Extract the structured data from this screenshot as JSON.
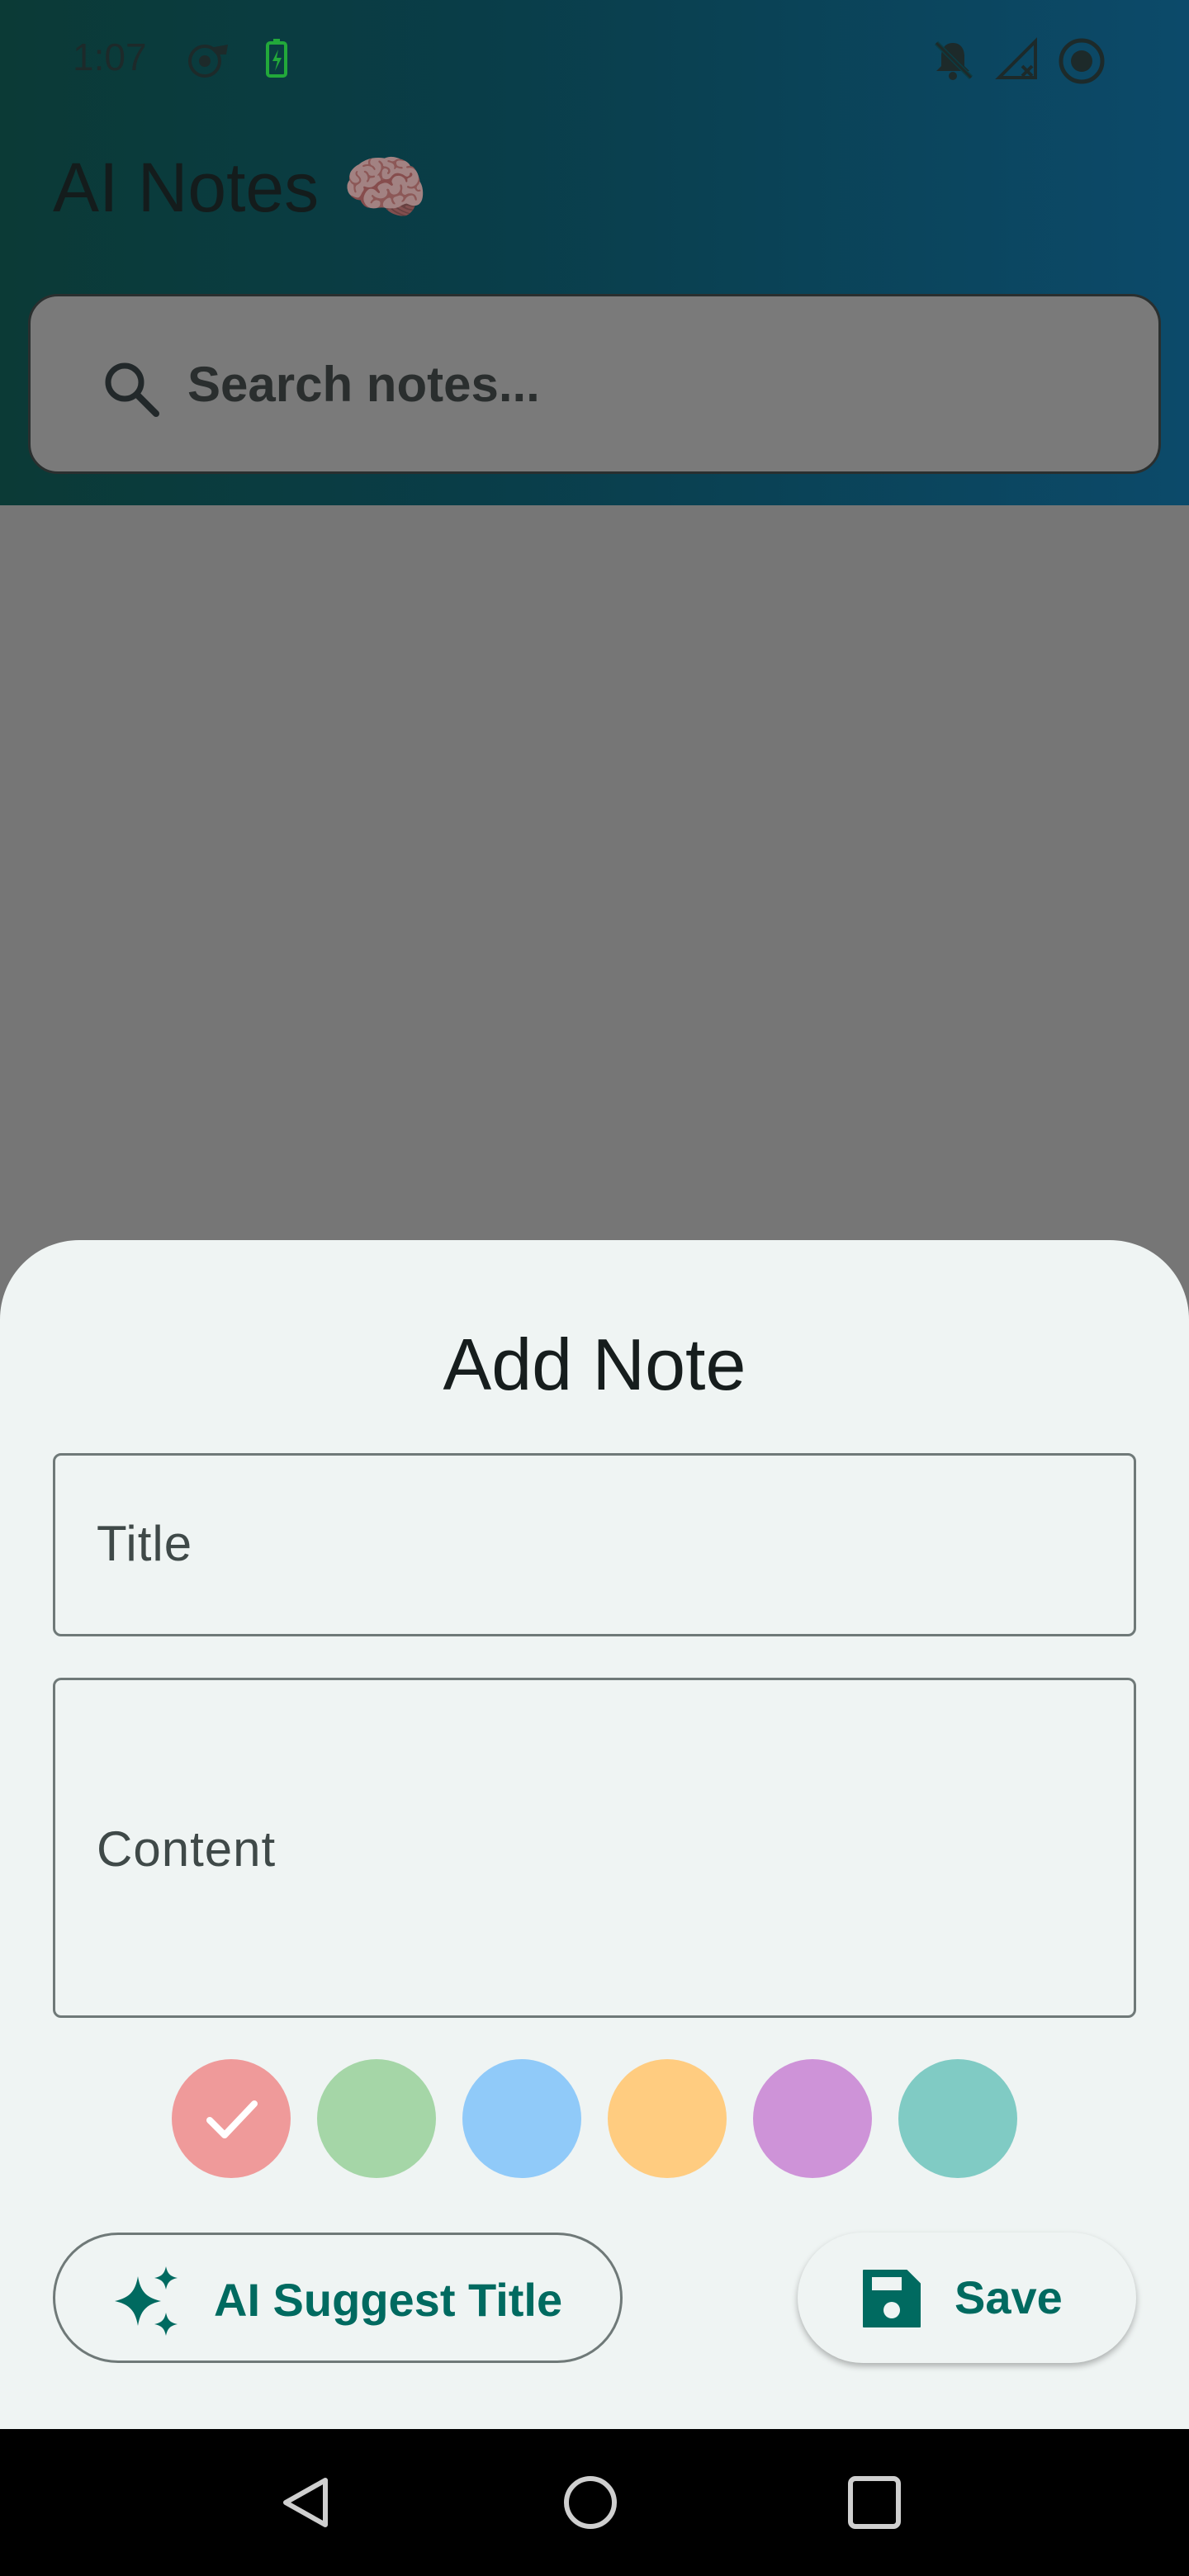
{
  "status_bar": {
    "time": "1:07",
    "icons_left": [
      "fan-icon",
      "battery-charging-icon"
    ],
    "icons_right": [
      "notifications-off-icon",
      "signal-off-icon",
      "record-icon"
    ]
  },
  "app": {
    "title": "AI Notes",
    "title_emoji": "🧠"
  },
  "search": {
    "placeholder": "Search notes..."
  },
  "sheet": {
    "title": "Add Note",
    "title_field": {
      "label": "Title"
    },
    "content_field": {
      "label": "Content"
    },
    "colors": [
      {
        "hex": "#ef9a9a",
        "selected": true
      },
      {
        "hex": "#a5d6a7",
        "selected": false
      },
      {
        "hex": "#90caf9",
        "selected": false
      },
      {
        "hex": "#ffcc80",
        "selected": false
      },
      {
        "hex": "#ce93d8",
        "selected": false
      },
      {
        "hex": "#80cbc4",
        "selected": false
      }
    ],
    "ai_button": {
      "label": "AI Suggest Title",
      "icon": "sparkle-icon"
    },
    "save_button": {
      "label": "Save",
      "icon": "save-icon"
    }
  },
  "theme": {
    "accent": "#006a60",
    "sheet_bg": "#eff4f3"
  },
  "nav": {
    "buttons": [
      "back-icon",
      "home-icon",
      "recents-icon"
    ]
  }
}
